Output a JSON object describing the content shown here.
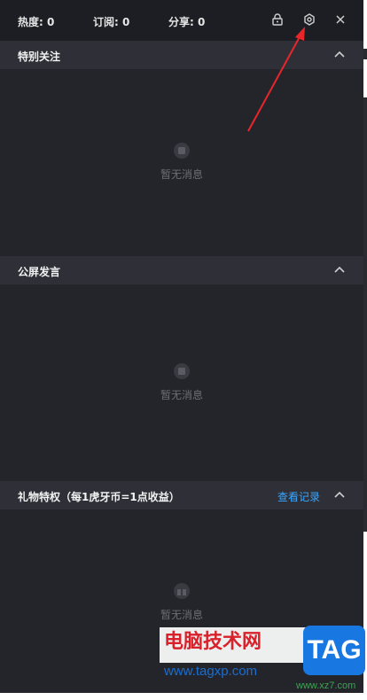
{
  "topbar": {
    "heat_label": "热度: 0",
    "subscribe_label": "订阅: 0",
    "share_label": "分享: 0",
    "icons": [
      "lock-icon",
      "settings-icon",
      "close-icon"
    ]
  },
  "sections": {
    "special": {
      "title": "特别关注",
      "empty_text": "暂无消息"
    },
    "public": {
      "title": "公屏发言",
      "empty_text": "暂无消息"
    },
    "gift": {
      "title": "礼物特权（每1虎牙币=1点收益）",
      "link": "查看记录",
      "empty_text": "暂无消息"
    }
  },
  "watermark": {
    "title": "电脑技术网",
    "url": "www.tagxp.com",
    "logo": "TAG",
    "url2": "www.xz7.com"
  },
  "colors": {
    "background": "#24252b",
    "header": "#2f3037",
    "topbar": "#1d1e23",
    "link": "#3aa6ff",
    "annotation_arrow": "#e8262a"
  }
}
